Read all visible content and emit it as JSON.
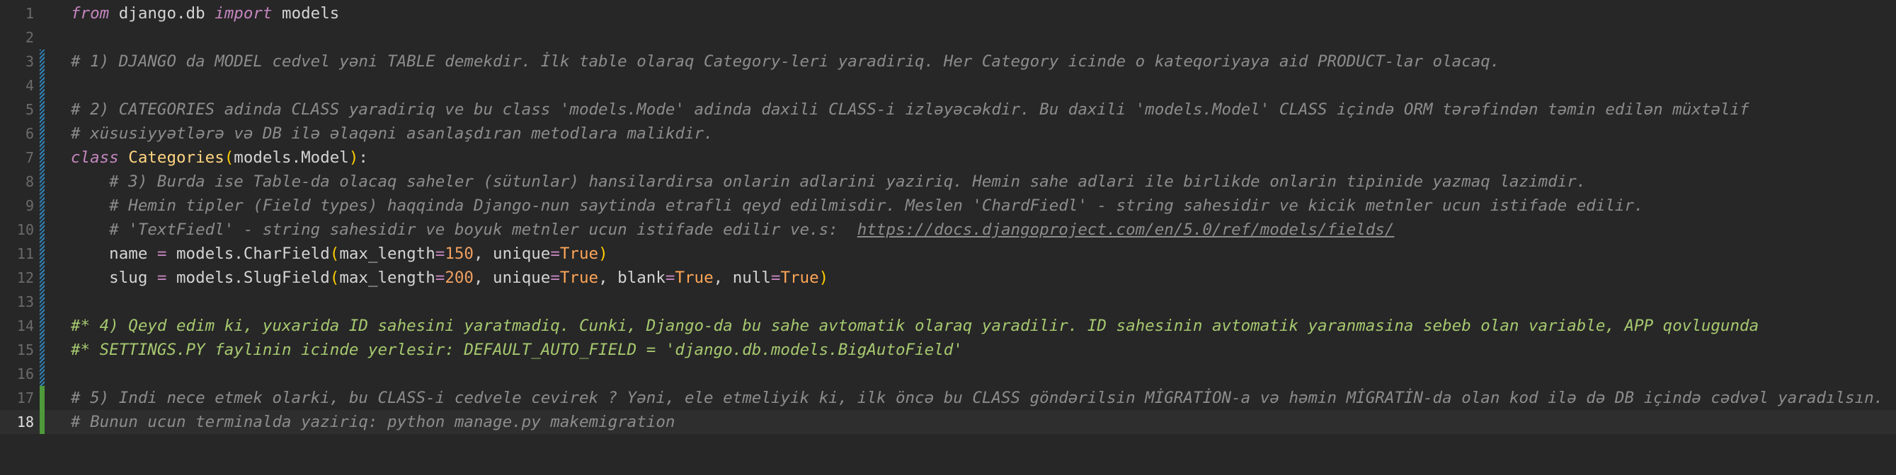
{
  "lines": [
    {
      "n": "1",
      "tokens": [
        {
          "t": "from",
          "c": "kw"
        },
        {
          "t": " django.db "
        },
        {
          "t": "import",
          "c": "kw"
        },
        {
          "t": " models"
        }
      ]
    },
    {
      "n": "2",
      "tokens": []
    },
    {
      "n": "3",
      "tokens": [
        {
          "t": "# 1) DJANGO da MODEL cedvel yəni TABLE demekdir. İlk table olaraq Category-leri yaradiriq. Her Category icinde o kateqoriyaya aid PRODUCT-lar olacaq.",
          "c": "cmt"
        }
      ]
    },
    {
      "n": "4",
      "tokens": []
    },
    {
      "n": "5",
      "tokens": [
        {
          "t": "# 2) CATEGORIES adinda CLASS yaradiriq ve bu class 'models.Mode' adinda daxili CLASS-i izləyəcəkdir. Bu daxili 'models.Model' CLASS içində ORM tərəfindən təmin edilən müxtəlif",
          "c": "cmt"
        }
      ]
    },
    {
      "n": "6",
      "tokens": [
        {
          "t": "# xüsusiyyətlərə və DB ilə əlaqəni asanlaşdıran metodlara malikdir.",
          "c": "cmt"
        }
      ]
    },
    {
      "n": "7",
      "tokens": [
        {
          "t": "class",
          "c": "kw2"
        },
        {
          "t": " "
        },
        {
          "t": "Categories",
          "c": "cls"
        },
        {
          "t": "(",
          "c": "paren"
        },
        {
          "t": "models.Model"
        },
        {
          "t": ")",
          "c": "paren"
        },
        {
          "t": ":"
        }
      ]
    },
    {
      "n": "8",
      "tokens": [
        {
          "t": "    "
        },
        {
          "t": "# 3) Burda ise Table-da olacaq saheler (sütunlar) hansilardirsa onlarin adlarini yaziriq. Hemin sahe adlari ile birlikde onlarin tipinide yazmaq lazimdir.",
          "c": "cmt"
        }
      ]
    },
    {
      "n": "9",
      "tokens": [
        {
          "t": "    "
        },
        {
          "t": "# Hemin tipler (Field types) haqqinda Django-nun saytinda etrafli qeyd edilmisdir. Meslen 'ChardFiedl' - string sahesidir ve kicik metnler ucun istifade edilir.",
          "c": "cmt"
        }
      ]
    },
    {
      "n": "10",
      "tokens": [
        {
          "t": "    "
        },
        {
          "t": "# 'TextFiedl' - string sahesidir ve boyuk metnler ucun istifade edilir ve.s:  ",
          "c": "cmt"
        },
        {
          "t": "https://docs.djangoproject.com/en/5.0/ref/models/fields/",
          "c": "cmt link"
        }
      ]
    },
    {
      "n": "11",
      "tokens": [
        {
          "t": "    name "
        },
        {
          "t": "=",
          "c": "op"
        },
        {
          "t": " models.CharField"
        },
        {
          "t": "(",
          "c": "paren"
        },
        {
          "t": "max_length"
        },
        {
          "t": "=",
          "c": "op"
        },
        {
          "t": "150",
          "c": "num"
        },
        {
          "t": ", unique"
        },
        {
          "t": "=",
          "c": "op"
        },
        {
          "t": "True",
          "c": "bool"
        },
        {
          "t": ")",
          "c": "paren"
        }
      ]
    },
    {
      "n": "12",
      "tokens": [
        {
          "t": "    slug "
        },
        {
          "t": "=",
          "c": "op"
        },
        {
          "t": " models.SlugField"
        },
        {
          "t": "(",
          "c": "paren"
        },
        {
          "t": "max_length"
        },
        {
          "t": "=",
          "c": "op"
        },
        {
          "t": "200",
          "c": "num"
        },
        {
          "t": ", unique"
        },
        {
          "t": "=",
          "c": "op"
        },
        {
          "t": "True",
          "c": "bool"
        },
        {
          "t": ", blank"
        },
        {
          "t": "=",
          "c": "op"
        },
        {
          "t": "True",
          "c": "bool"
        },
        {
          "t": ", null"
        },
        {
          "t": "=",
          "c": "op"
        },
        {
          "t": "True",
          "c": "bool"
        },
        {
          "t": ")",
          "c": "paren"
        }
      ]
    },
    {
      "n": "13",
      "tokens": []
    },
    {
      "n": "14",
      "tokens": [
        {
          "t": "#* 4) Qeyd edim ki, yuxarida ID sahesini yaratmadiq. Cunki, Django-da bu sahe avtomatik olaraq yaradilir. ID sahesinin avtomatik yaranmasina sebeb olan variable, APP qovlugunda",
          "c": "cmt-green"
        }
      ]
    },
    {
      "n": "15",
      "tokens": [
        {
          "t": "#* SETTINGS.PY faylinin icinde yerlesir: DEFAULT_AUTO_FIELD = 'django.db.models.BigAutoField'",
          "c": "cmt-green"
        }
      ]
    },
    {
      "n": "16",
      "tokens": []
    },
    {
      "n": "17",
      "tokens": [
        {
          "t": "# 5) Indi nece etmek olarki, bu CLASS-i cedvele cevirek ? Yəni, ele etmeliyik ki, ilk öncə bu CLASS göndərilsin MİGRATİON-a və həmin MİGRATİN-da olan kod ilə də DB içində cədvəl yaradılsın.",
          "c": "cmt"
        }
      ]
    },
    {
      "n": "18",
      "tokens": [
        {
          "t": "# Bunun ucun terminalda yaziriq: python manage.py makemigration",
          "c": "cmt"
        }
      ]
    }
  ],
  "current_line": "18",
  "colors": {
    "background": "#272727",
    "keyword": "#c586c0",
    "class_name": "#ffd580",
    "number": "#f0a060",
    "comment": "#8c8c8c",
    "comment_highlight": "#a6c86f"
  }
}
